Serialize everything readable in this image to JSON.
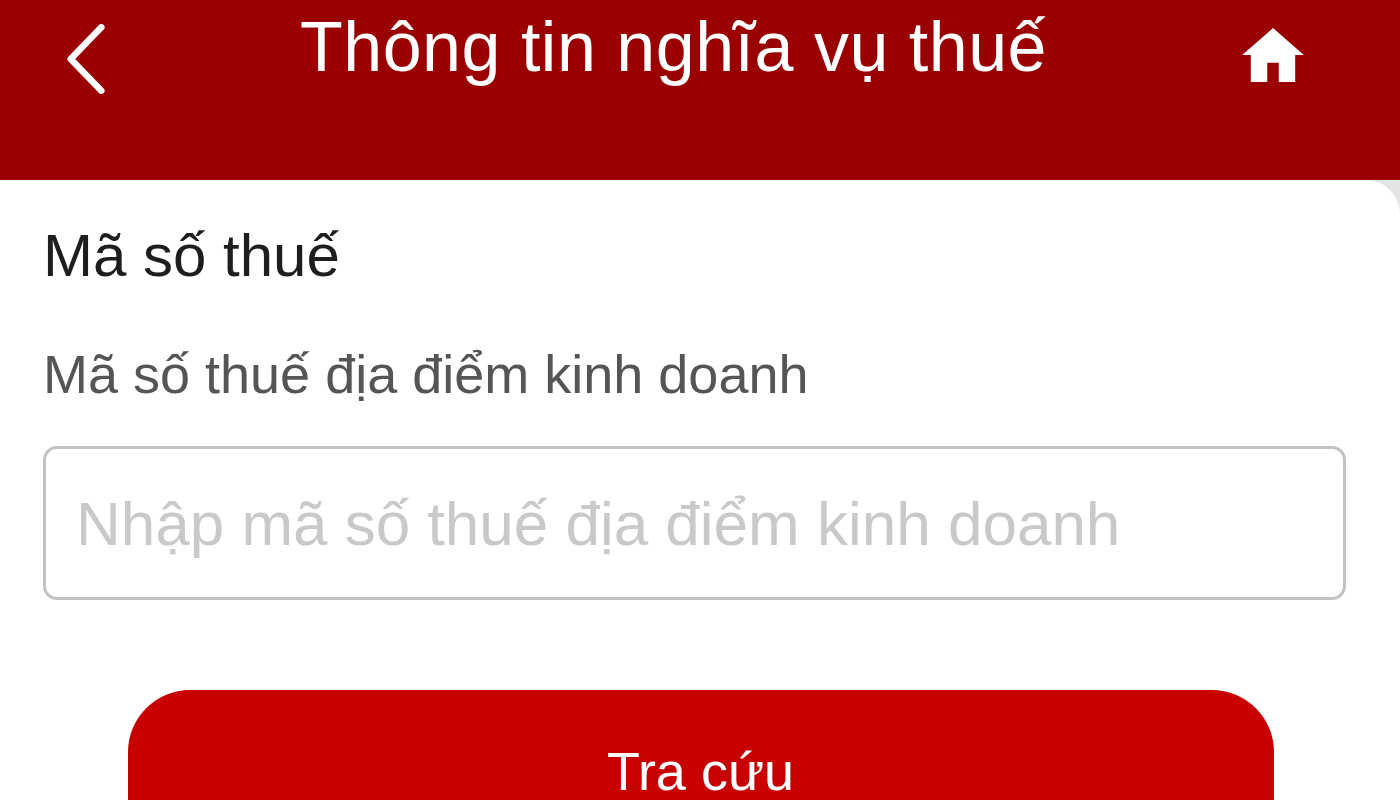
{
  "header": {
    "title": "Thông tin nghĩa vụ thuế"
  },
  "section_title": "Mã số thuế",
  "field": {
    "label": "Mã số thuế địa điểm kinh doanh",
    "placeholder": "Nhập mã số thuế địa điểm kinh doanh"
  },
  "buttons": [
    "Tra cứu"
  ]
}
